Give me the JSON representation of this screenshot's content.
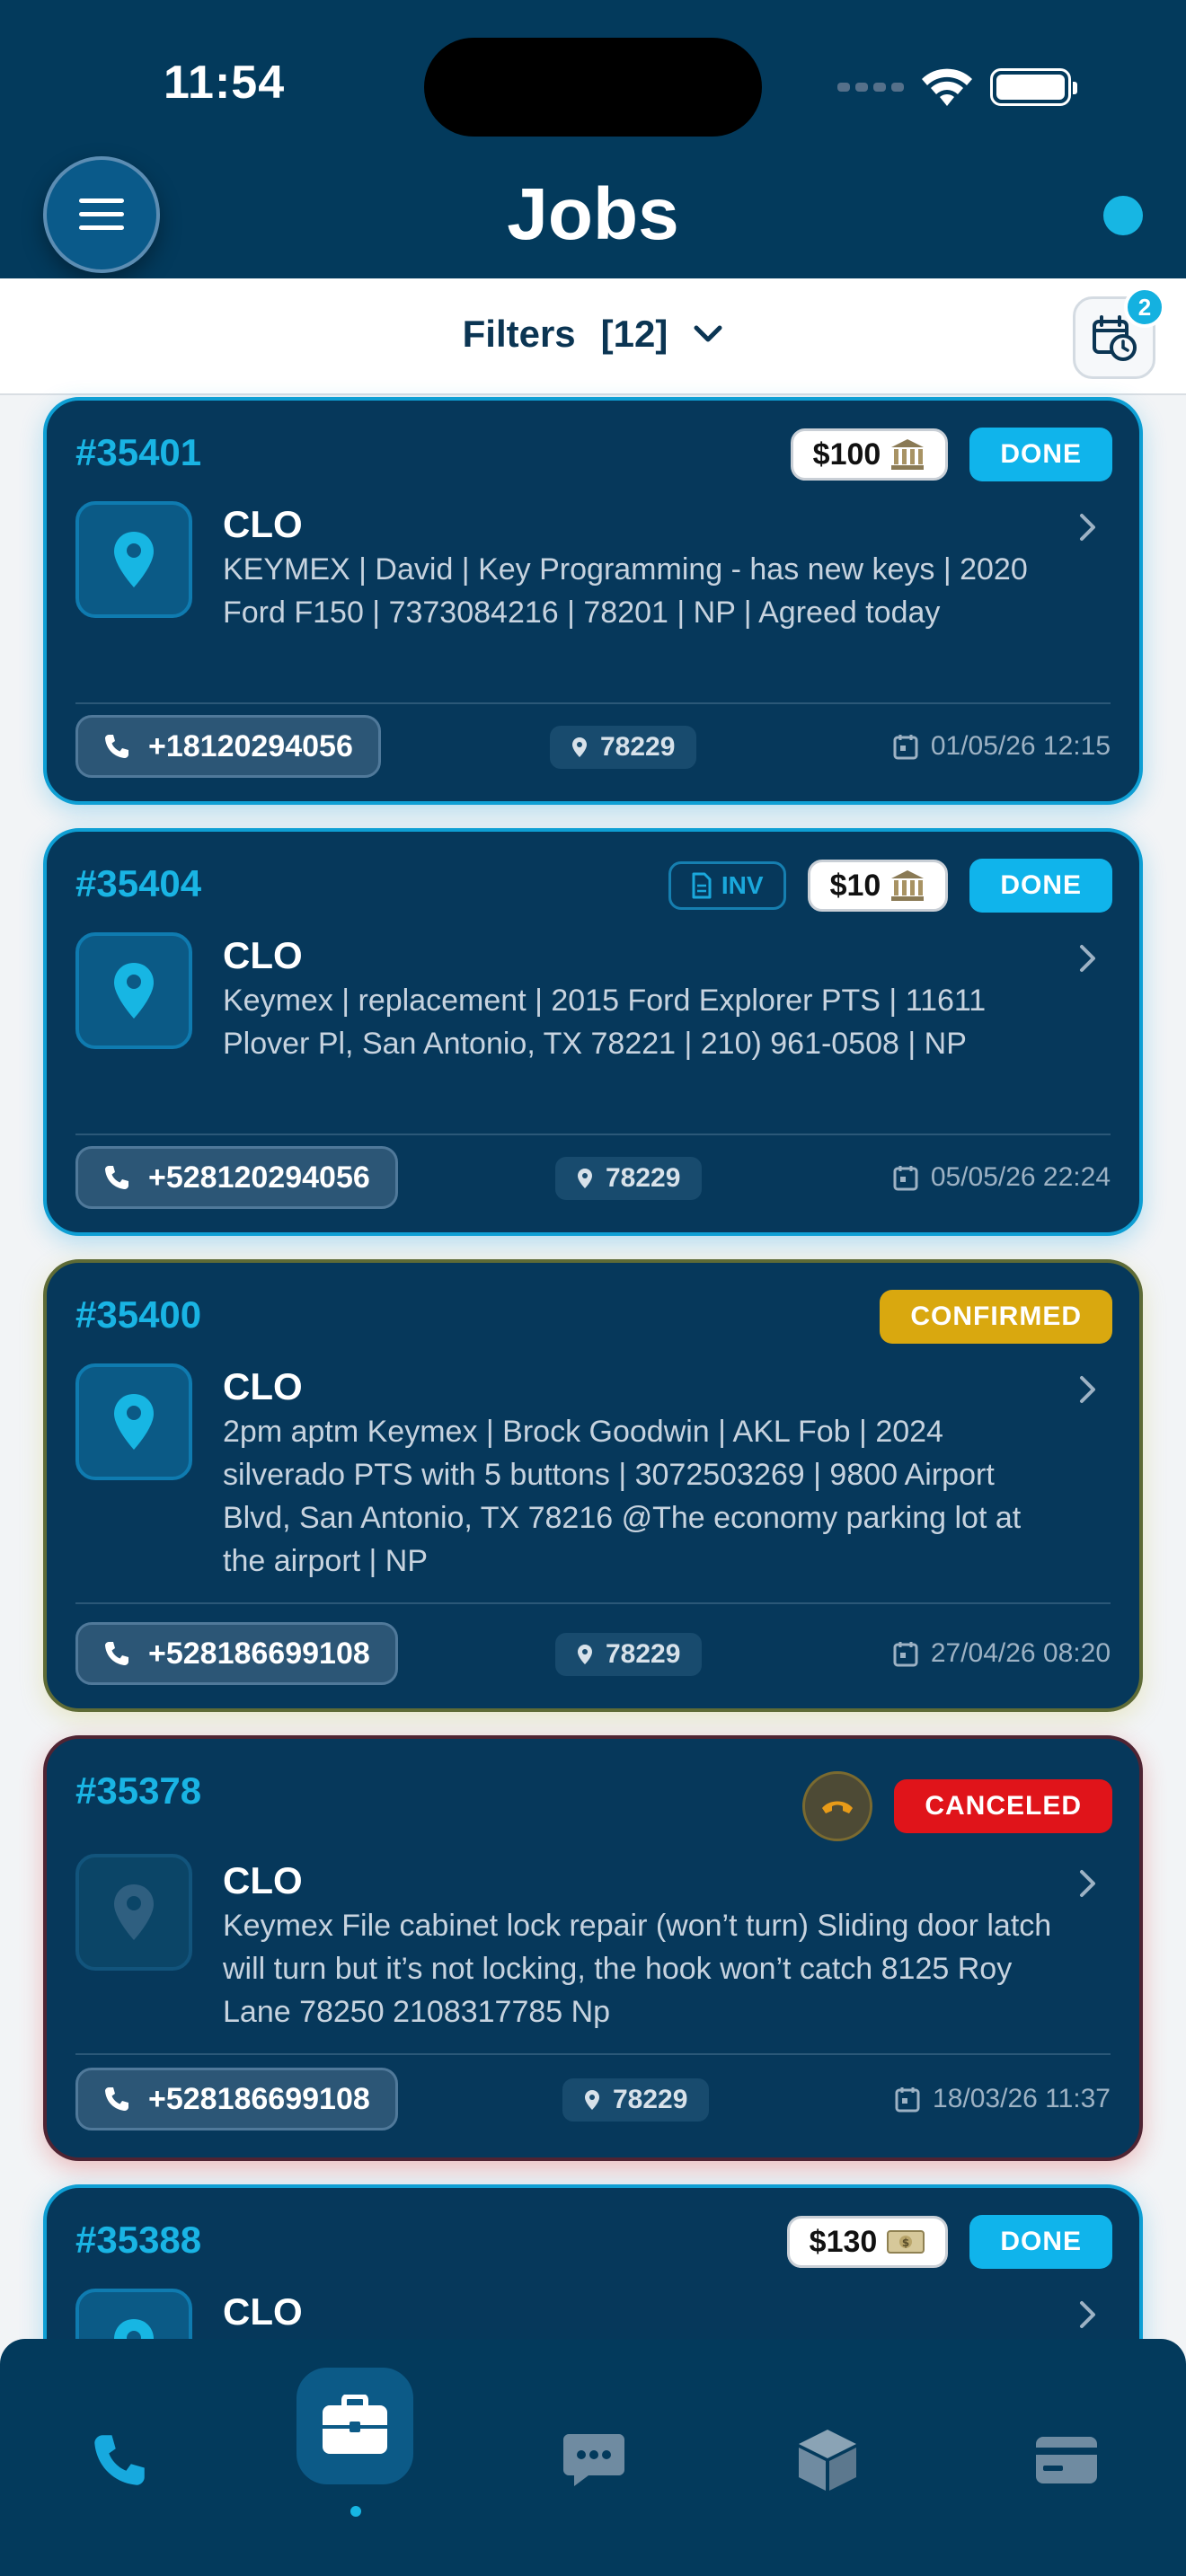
{
  "status_bar": {
    "time": "11:54"
  },
  "header": {
    "title": "Jobs"
  },
  "filters": {
    "label": "Filters",
    "count": "[12]",
    "calendar_badge": "2"
  },
  "jobs": [
    {
      "id": "#35401",
      "price": "$100",
      "status": "DONE",
      "client": "CLO",
      "description": "KEYMEX | David | Key Programming - has new keys | 2020 Ford F150 | 7373084216 | 78201 | NP | Agreed today",
      "phone": "+18120294056",
      "zip": "78229",
      "date": "01/05/26 12:15"
    },
    {
      "id": "#35404",
      "inv": "INV",
      "price": "$10",
      "status": "DONE",
      "client": "CLO",
      "description": "Keymex | replacement | 2015 Ford Explorer PTS | 11611 Plover Pl, San Antonio, TX 78221 | 210) 961-0508 | NP",
      "phone": "+528120294056",
      "zip": "78229",
      "date": "05/05/26 22:24"
    },
    {
      "id": "#35400",
      "status": "CONFIRMED",
      "client": "CLO",
      "description": "2pm aptm Keymex | Brock Goodwin | AKL Fob | 2024 silverado PTS with 5 buttons | 3072503269 | 9800 Airport Blvd, San Antonio, TX 78216 @The economy parking lot at the airport | NP",
      "phone": "+528186699108",
      "zip": "78229",
      "date": "27/04/26 08:20"
    },
    {
      "id": "#35378",
      "status": "CANCELED",
      "client": "CLO",
      "description": "Keymex File cabinet lock repair (won’t turn) Sliding door latch will turn but it’s not locking, the hook won’t catch 8125 Roy Lane 78250 2108317785 Np",
      "phone": "+528186699108",
      "zip": "78229",
      "date": "18/03/26 11:37"
    },
    {
      "id": "#35388",
      "price": "$130",
      "status": "DONE",
      "client": "CLO"
    }
  ],
  "icons": {
    "menu": "menu-icon",
    "calendar": "calendar-clock-icon",
    "location": "location-pin-icon",
    "bank": "bank-icon",
    "cash": "cash-icon",
    "document": "document-icon",
    "phone": "phone-icon",
    "date": "calendar-icon",
    "chevron": "chevron-right-icon"
  },
  "nav": [
    "phone-icon",
    "briefcase-icon",
    "chat-icon",
    "box-icon",
    "card-icon"
  ],
  "colors": {
    "header": "#033a5c",
    "card": "#06385b",
    "accent": "#19b4e4",
    "done": "#10b4eb",
    "confirmed": "#d9a80f",
    "canceled": "#e0141a"
  }
}
